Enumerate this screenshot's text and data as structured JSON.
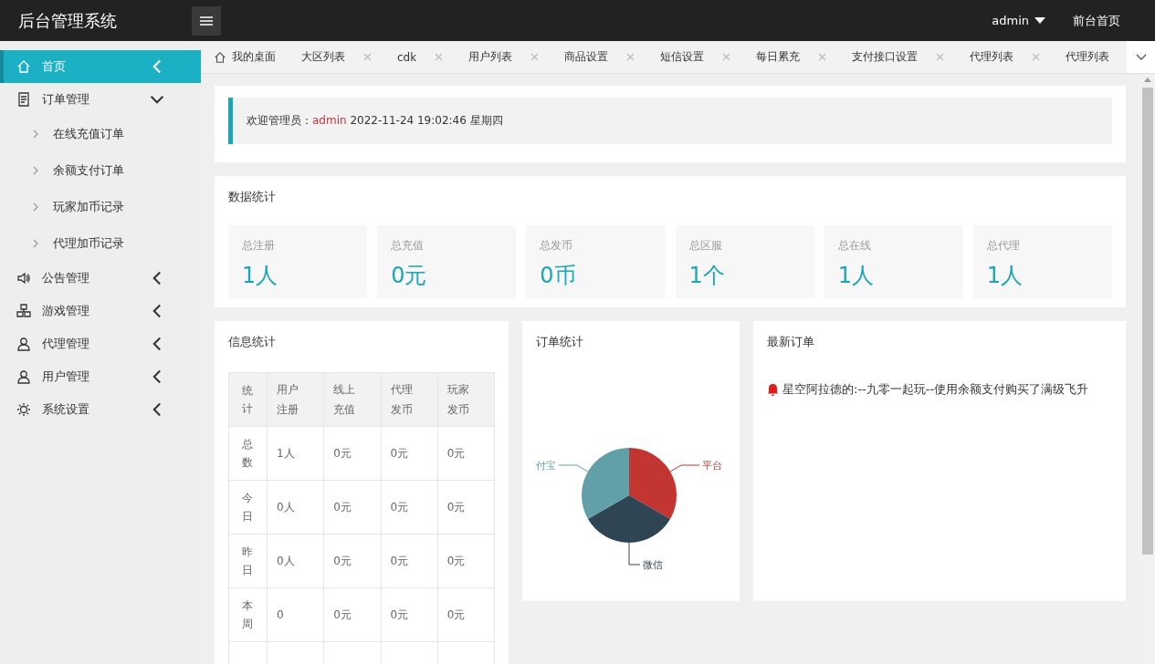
{
  "header": {
    "title": "后台管理系统",
    "user": "admin",
    "home_link": "前台首页"
  },
  "sidebar": {
    "items": [
      {
        "label": "首页",
        "selected": true,
        "expanded": false
      },
      {
        "label": "订单管理",
        "selected": false,
        "expanded": true,
        "children": [
          {
            "label": "在线充值订单"
          },
          {
            "label": "余额支付订单"
          },
          {
            "label": "玩家加币记录"
          },
          {
            "label": "代理加币记录"
          }
        ]
      },
      {
        "label": "公告管理",
        "selected": false,
        "expanded": false
      },
      {
        "label": "游戏管理",
        "selected": false,
        "expanded": false
      },
      {
        "label": "代理管理",
        "selected": false,
        "expanded": false
      },
      {
        "label": "用户管理",
        "selected": false,
        "expanded": false
      },
      {
        "label": "系统设置",
        "selected": false,
        "expanded": false
      }
    ]
  },
  "tabs": [
    {
      "label": "我的桌面",
      "closable": false
    },
    {
      "label": "大区列表",
      "closable": true
    },
    {
      "label": "cdk",
      "closable": true
    },
    {
      "label": "用户列表",
      "closable": true
    },
    {
      "label": "商品设置",
      "closable": true
    },
    {
      "label": "短信设置",
      "closable": true
    },
    {
      "label": "每日累充",
      "closable": true
    },
    {
      "label": "支付接口设置",
      "closable": true
    },
    {
      "label": "代理列表",
      "closable": true
    },
    {
      "label": "代理列表",
      "closable": false
    }
  ],
  "welcome": {
    "text": "欢迎管理员：",
    "user": "admin",
    "datetime": "2022-11-24  19:02:46  星期四"
  },
  "data_stats": {
    "title": "数据统计",
    "items": [
      {
        "label": "总注册",
        "value": "1人"
      },
      {
        "label": "总充值",
        "value": "0元"
      },
      {
        "label": "总发币",
        "value": "0币"
      },
      {
        "label": "总区服",
        "value": "1个"
      },
      {
        "label": "总在线",
        "value": "1人"
      },
      {
        "label": "总代理",
        "value": "1人"
      }
    ]
  },
  "info_stats": {
    "title": "信息统计",
    "columns": [
      "统计",
      "用户注册",
      "线上充值",
      "代理发币",
      "玩家发币"
    ],
    "rows": [
      [
        "总数",
        "1人",
        "0元",
        "0元",
        "0元"
      ],
      [
        "今日",
        "0人",
        "0元",
        "0元",
        "0元"
      ],
      [
        "昨日",
        "0人",
        "0元",
        "0元",
        "0元"
      ],
      [
        "本周",
        "0",
        "0元",
        "0元",
        "0元"
      ]
    ]
  },
  "order_stats": {
    "title": "订单统计",
    "slices": [
      {
        "label": "平台",
        "color": "#c23531"
      },
      {
        "label": "微信",
        "color": "#2f4554"
      },
      {
        "label": "付宝",
        "color": "#61a0a8"
      }
    ]
  },
  "latest_orders": {
    "title": "最新订单",
    "items": [
      "星空阿拉德的:--九零一起玩--使用余额支付购买了满级飞升"
    ]
  }
}
